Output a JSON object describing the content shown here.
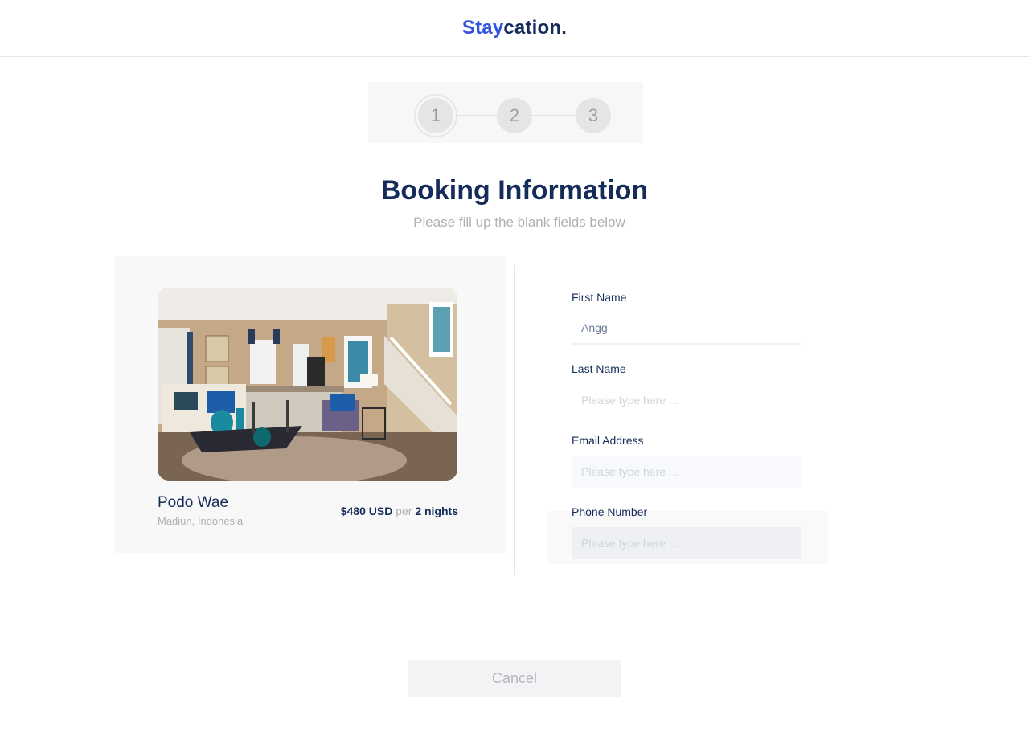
{
  "header": {
    "brand_part1": "Stay",
    "brand_part2": "cation."
  },
  "stepper": {
    "steps": [
      "1",
      "2",
      "3"
    ],
    "active_step": 1
  },
  "page": {
    "title": "Booking Information",
    "subtitle": "Please fill up the blank fields below"
  },
  "property": {
    "image_alt": "Living room interior",
    "name": "Podo Wae",
    "location": "Madiun, Indonesia",
    "price": "$480 USD",
    "per_label": "per",
    "duration": "2 nights"
  },
  "form": {
    "first_name": {
      "label": "First Name",
      "value": "Angg",
      "placeholder": "Please type here ..."
    },
    "last_name": {
      "label": "Last Name",
      "value": "",
      "placeholder": "Please type here ..."
    },
    "email": {
      "label": "Email Address",
      "value": "",
      "placeholder": "Please type here ..."
    },
    "phone": {
      "label": "Phone Number",
      "value": "",
      "placeholder": "Please type here ..."
    }
  },
  "actions": {
    "cancel_label": "Cancel"
  }
}
